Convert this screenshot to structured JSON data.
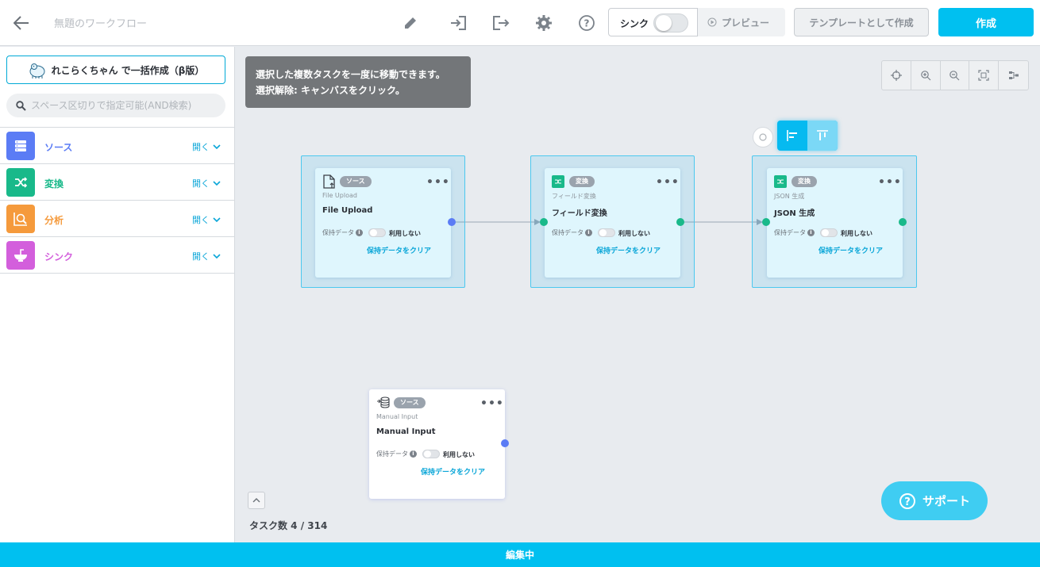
{
  "header": {
    "title": "無題のワークフロー",
    "sync_label": "シンク",
    "preview_label": "プレビュー",
    "template_label": "テンプレートとして作成",
    "create_label": "作成"
  },
  "sidebar": {
    "ai_button_label": "れこらくちゃん で一括作成（β版）",
    "search_placeholder": "スペース区切りで指定可能(AND検索)",
    "categories": [
      {
        "label": "ソース",
        "open": "開く",
        "color": "#5b7cf5"
      },
      {
        "label": "変換",
        "open": "開く",
        "color": "#19b98a"
      },
      {
        "label": "分析",
        "open": "開く",
        "color": "#f59a3c"
      },
      {
        "label": "シンク",
        "open": "開く",
        "color": "#d35fdc"
      }
    ]
  },
  "canvas": {
    "hint_line1": "選択した複数タスクを一度に移動できます。",
    "hint_line2": "選択解除: キャンバスをクリック。",
    "task_count": "タスク数 4 / 314",
    "support_label": "サポート",
    "tasks": [
      {
        "badge": "ソース",
        "subtitle": "File Upload",
        "name": "File Upload",
        "keep_label": "保持データ",
        "use_label": "利用しない",
        "clear_label": "保持データをクリア"
      },
      {
        "badge": "変換",
        "subtitle": "フィールド変換",
        "name": "フィールド変換",
        "keep_label": "保持データ",
        "use_label": "利用しない",
        "clear_label": "保持データをクリア"
      },
      {
        "badge": "変換",
        "subtitle": "JSON 生成",
        "name": "JSON 生成",
        "keep_label": "保持データ",
        "use_label": "利用しない",
        "clear_label": "保持データをクリア"
      },
      {
        "badge": "ソース",
        "subtitle": "Manual Input",
        "name": "Manual Input",
        "keep_label": "保持データ",
        "use_label": "利用しない",
        "clear_label": "保持データをクリア"
      }
    ]
  },
  "footer": {
    "status": "編集中"
  },
  "colors": {
    "accent": "#00c0f0",
    "source": "#5b7cf5",
    "transform": "#19b98a"
  }
}
